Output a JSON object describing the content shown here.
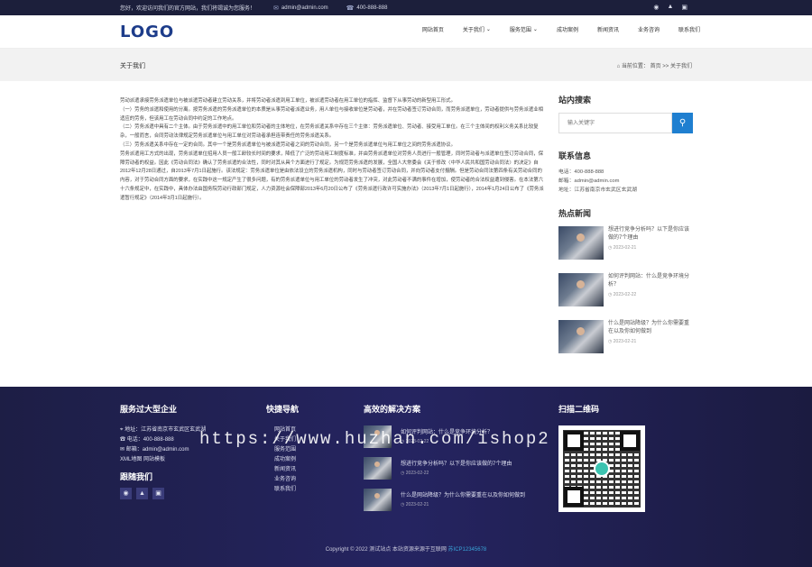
{
  "topbar": {
    "welcome": "您好，欢迎访问我们的官方网站，我们将竭诚为您服务！",
    "email": "admin@admin.com",
    "phone": "400-888-888",
    "right_icons": [
      "wechat-icon",
      "qq-icon",
      "cart-icon"
    ]
  },
  "header": {
    "logo": "LOGO",
    "nav": [
      "网站首页",
      "关于我们",
      "服务范围",
      "成功案例",
      "新闻资讯",
      "业务咨询",
      "联系我们"
    ]
  },
  "banner": {
    "title": "关于我们",
    "breadcrumb_label": "当前位置：",
    "breadcrumb_home": "首页",
    "breadcrumb_sep": ">>",
    "breadcrumb_current": "关于我们"
  },
  "article": {
    "paragraphs": [
      "劳动派遣承接劳务派遣单位与被派遣劳动者建立劳动关系，并将劳动者派遣到用工单位，被派遣劳动者在用工单位的指挥、监督下从事劳动的新型用工形式。",
      "（一）劳务的派遣和使用的分离。按劳务派遣的劳务派遣单位的本质是从事劳动者派遣业务，用人单位与接收单位是劳动者，并在劳动者签订劳动合同，而劳务派遣单位，劳动者提供与劳务派遣业相适应的劳务，但该用工在劳动合同中约定的工作地点。",
      "（二）劳务派遣中具有二个主体。由于劳务派遣中的用工单位和劳动者的主体地位，在劳务派遣关系中存在三个主体：劳务派遣单位、劳动者、接受用工单位。在三个主体间的权利义务关系比较复杂，一般而言，合同劳动法律规定劳务派遣单位与用工单位对劳动者承担连带责任的劳务派遣关系。",
      "（三）劳务派遣关系中存在一定的合同。其中一个是劳务派遣单位与被派遣劳动者之间的劳动合同，另一个是劳务派遣单位与用工单位之间的劳务派遣协议。",
      "劳务派遣用工方式的出现，劳务派遣单位招用人员一般工龄较长时间的要求，降低了广泛的劳动用工制度标准，并由劳务派遣单位对劳务人员进行一般管理，同时劳动者与派遣单位签订劳动合同，保障劳动者的权益。因此《劳动合同法》确认了劳务派遣的合法性，同时对其从具个方面进行了规定。为规范劳务派遣的发展，全国人大常委会《关于修改〈中华人民共和国劳动合同法〉的决定》自2012年12月28日通过，自2013年7月1日起施行。该法规定：劳务派遣单位是由依法设立的劳务派遣机构，同时与劳动者签订劳动合同，并向劳动者支付报酬。但是劳动合同法第四条有关劳动合同的内容，对于劳动合同方面的要求，在实践中这一规定产生了很多问题，有的劳务派遣单位与用工单位的劳动者发生了冲突，对此劳动者不满的事件在增加，使劳动者的合法权益遭到侵害。在本法第六十六条规定中，在实践中，具体办法由国务院劳动行政部门规定，人力资源社会保障部2013年6月20日公布了《劳务派遣行政许可实施办法》（2013年7月1日起施行），2014年1月24日公布了《劳务派遣暂行规定》（2014年3月1日起施行）。"
    ]
  },
  "sidebar": {
    "search_title": "站内搜索",
    "search_placeholder": "输入关键字",
    "contact_title": "联系信息",
    "contact_phone": "电话：400-888-888",
    "contact_email": "邮箱：admin@admin.com",
    "contact_address": "地址：江苏省南京市玄武区玄武湖",
    "hot_title": "热点新闻",
    "hot_news": [
      {
        "title": "想进行竞争分析吗？以下是你应该做的7个理由",
        "date": "2023-02-21"
      },
      {
        "title": "如何评判网站：什么是竞争环境分析？",
        "date": "2023-02-22"
      },
      {
        "title": "什么是网站降级？为什么你需要重在以及你如何做到",
        "date": "2023-02-21"
      }
    ]
  },
  "footer": {
    "col1_title": "服务过大型企业",
    "col1_address": "地址：江苏省南京市玄武区玄武湖",
    "col1_phone": "电话：400-888-888",
    "col1_email": "邮箱：admin@admin.com",
    "col1_links": "XML地图 网站模板",
    "follow_title": "跟随我们",
    "col2_title": "快捷导航",
    "col2_links": [
      "网站首页",
      "关于我们",
      "服务范围",
      "成功案例",
      "新闻资讯",
      "业务咨询",
      "联系我们"
    ],
    "col3_title": "高效的解决方案",
    "col3_items": [
      {
        "title": "如何评判网站：什么是竞争环境分析？",
        "date": "2023-02-22"
      },
      {
        "title": "想进行竞争分析吗？以下是你应该做的7个理由",
        "date": "2023-02-22"
      },
      {
        "title": "什么是网站降级？为什么你需要重在以及你如何做到",
        "date": "2023-02-21"
      }
    ],
    "col4_title": "扫描二维码",
    "copyright": "Copyright © 2022 测试站点 本站资源来源于互联网",
    "icp": "苏ICP12345678"
  },
  "watermark": "https://www.huzhan.com/ishop2"
}
